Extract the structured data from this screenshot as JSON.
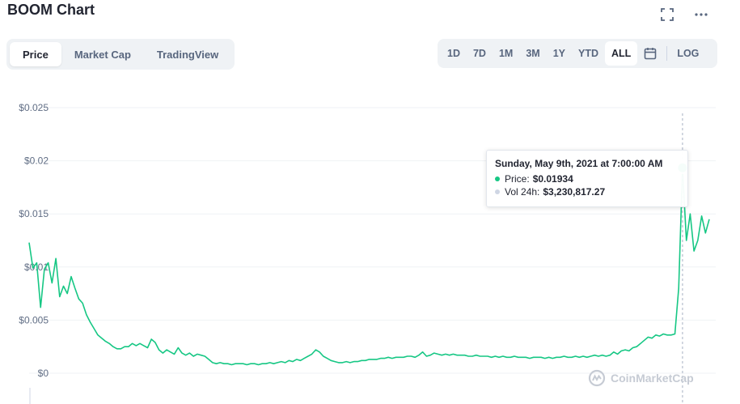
{
  "header": {
    "title": "BOOM Chart"
  },
  "icons": {
    "fullscreen": "fullscreen-icon",
    "more": "more-icon",
    "calendar": "calendar-icon",
    "logo": "coinmarketcap-logo-icon"
  },
  "tabs": [
    {
      "label": "Price",
      "active": true
    },
    {
      "label": "Market Cap",
      "active": false
    },
    {
      "label": "TradingView",
      "active": false
    }
  ],
  "ranges": [
    {
      "label": "1D",
      "active": false
    },
    {
      "label": "7D",
      "active": false
    },
    {
      "label": "1M",
      "active": false
    },
    {
      "label": "3M",
      "active": false
    },
    {
      "label": "1Y",
      "active": false
    },
    {
      "label": "YTD",
      "active": false
    },
    {
      "label": "ALL",
      "active": true
    }
  ],
  "log_label": "LOG",
  "tooltip": {
    "title": "Sunday, May 9th, 2021 at 7:00:00 AM",
    "price_label": "Price:",
    "price_value": "$0.01934",
    "vol_label": "Vol 24h:",
    "vol_value": "$3,230,817.27"
  },
  "watermark": "CoinMarketCap",
  "colors": {
    "line": "#16c784",
    "grid": "#eff2f5",
    "muted": "#58667e",
    "vol_dot": "#cfd6e4"
  },
  "chart_data": {
    "type": "line",
    "title": "BOOM Chart",
    "xlabel": "",
    "ylabel": "",
    "ylim": [
      0,
      0.025
    ],
    "yticks": [
      "$0",
      "$0.005",
      "$0.01",
      "$0.015",
      "$0.02",
      "$0.025"
    ],
    "grid": true,
    "x_end_label": "May 9th, 2021",
    "series": [
      {
        "values": [
          0.0123,
          0.0099,
          0.0104,
          0.0062,
          0.0098,
          0.0104,
          0.0085,
          0.0108,
          0.0072,
          0.0082,
          0.0075,
          0.0091,
          0.008,
          0.007,
          0.0066,
          0.0055,
          0.0048,
          0.0042,
          0.0036,
          0.0033,
          0.003,
          0.0028,
          0.0025,
          0.0023,
          0.0023,
          0.0025,
          0.0025,
          0.0028,
          0.0026,
          0.0028,
          0.0026,
          0.0024,
          0.0032,
          0.0029,
          0.0022,
          0.0019,
          0.0022,
          0.002,
          0.0018,
          0.0024,
          0.0019,
          0.0017,
          0.0019,
          0.0016,
          0.0018,
          0.0017,
          0.0016,
          0.0013,
          0.001,
          0.0009,
          0.001,
          0.0009,
          0.0009,
          0.0008,
          0.0009,
          0.0009,
          0.0009,
          0.0008,
          0.0009,
          0.0009,
          0.0008,
          0.0009,
          0.0009,
          0.001,
          0.0009,
          0.001,
          0.0011,
          0.001,
          0.0012,
          0.0011,
          0.0013,
          0.0012,
          0.0014,
          0.0016,
          0.0018,
          0.0022,
          0.002,
          0.0016,
          0.0014,
          0.0012,
          0.0011,
          0.001,
          0.001,
          0.0011,
          0.001,
          0.0011,
          0.0011,
          0.0012,
          0.0012,
          0.0013,
          0.0013,
          0.0013,
          0.0014,
          0.0014,
          0.0015,
          0.0014,
          0.0015,
          0.0015,
          0.0015,
          0.0016,
          0.0016,
          0.0015,
          0.0017,
          0.002,
          0.0016,
          0.0017,
          0.0019,
          0.0018,
          0.0017,
          0.0018,
          0.0017,
          0.0018,
          0.0017,
          0.0017,
          0.0017,
          0.0016,
          0.0016,
          0.0017,
          0.0016,
          0.0016,
          0.0016,
          0.0015,
          0.0016,
          0.0015,
          0.0016,
          0.0015,
          0.0015,
          0.0016,
          0.0015,
          0.0015,
          0.0015,
          0.0014,
          0.0015,
          0.0015,
          0.0015,
          0.0014,
          0.0015,
          0.0014,
          0.0015,
          0.0015,
          0.0016,
          0.0015,
          0.0015,
          0.0016,
          0.0015,
          0.0016,
          0.0015,
          0.0016,
          0.0017,
          0.0016,
          0.0017,
          0.0016,
          0.0017,
          0.002,
          0.0018,
          0.0021,
          0.0022,
          0.0021,
          0.0024,
          0.0025,
          0.0028,
          0.0031,
          0.0034,
          0.0033,
          0.0036,
          0.0035,
          0.0037,
          0.0036,
          0.0036,
          0.0037,
          0.008,
          0.0193,
          0.0125,
          0.015,
          0.0115,
          0.0125,
          0.0148,
          0.0132,
          0.0145
        ]
      }
    ],
    "highlight": {
      "price": 0.01934,
      "label": "May 9th, 2021"
    }
  }
}
